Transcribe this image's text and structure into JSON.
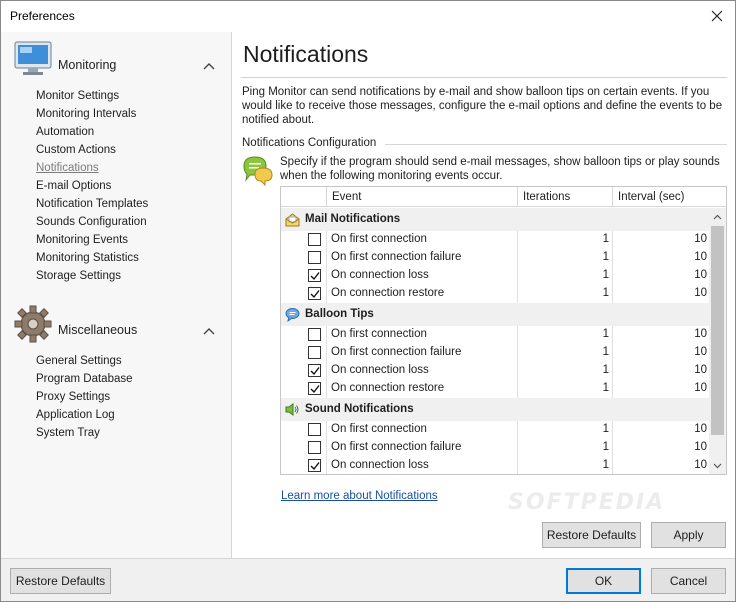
{
  "window": {
    "title": "Preferences"
  },
  "sidebar": {
    "groups": [
      {
        "title": "Monitoring",
        "icon": "monitor-icon",
        "items": [
          "Monitor Settings",
          "Monitoring Intervals",
          "Automation",
          "Custom Actions",
          "Notifications",
          "E-mail Options",
          "Notification Templates",
          "Sounds Configuration",
          "Monitoring Events",
          "Monitoring Statistics",
          "Storage Settings"
        ],
        "active": "Notifications"
      },
      {
        "title": "Miscellaneous",
        "icon": "gear-icon",
        "items": [
          "General Settings",
          "Program Database",
          "Proxy Settings",
          "Application Log",
          "System Tray"
        ]
      }
    ]
  },
  "main": {
    "title": "Notifications",
    "intro": "Ping Monitor can send notifications by e-mail and show balloon tips on certain events. If you would like to receive those messages, configure the e-mail options and define the events to be notified about.",
    "section_label": "Notifications Configuration",
    "description": "Specify if the program should send e-mail messages, show balloon tips or play sounds when the following monitoring events occur.",
    "grid": {
      "columns": [
        "Event",
        "Iterations",
        "Interval (sec)"
      ],
      "sections": [
        {
          "title": "Mail Notifications",
          "icon": "mail-icon",
          "rows": [
            {
              "checked": false,
              "event": "On first connection",
              "iterations": "1",
              "interval": "10"
            },
            {
              "checked": false,
              "event": "On first connection failure",
              "iterations": "1",
              "interval": "10"
            },
            {
              "checked": true,
              "event": "On connection loss",
              "iterations": "1",
              "interval": "10"
            },
            {
              "checked": true,
              "event": "On connection restore",
              "iterations": "1",
              "interval": "10"
            }
          ]
        },
        {
          "title": "Balloon Tips",
          "icon": "balloon-icon",
          "rows": [
            {
              "checked": false,
              "event": "On first connection",
              "iterations": "1",
              "interval": "10"
            },
            {
              "checked": false,
              "event": "On first connection failure",
              "iterations": "1",
              "interval": "10"
            },
            {
              "checked": true,
              "event": "On connection loss",
              "iterations": "1",
              "interval": "10"
            },
            {
              "checked": true,
              "event": "On connection restore",
              "iterations": "1",
              "interval": "10"
            }
          ]
        },
        {
          "title": "Sound Notifications",
          "icon": "speaker-icon",
          "rows": [
            {
              "checked": false,
              "event": "On first connection",
              "iterations": "1",
              "interval": "10"
            },
            {
              "checked": false,
              "event": "On first connection failure",
              "iterations": "1",
              "interval": "10"
            },
            {
              "checked": true,
              "event": "On connection loss",
              "iterations": "1",
              "interval": "10"
            }
          ]
        }
      ]
    },
    "learn_link": "Learn more about Notifications",
    "restore_defaults": "Restore Defaults",
    "apply": "Apply"
  },
  "footer": {
    "restore_defaults": "Restore Defaults",
    "ok": "OK",
    "cancel": "Cancel"
  },
  "watermark": "SOFTPEDIA",
  "colors": {
    "accent": "#0078d7",
    "link": "#1a4f9c",
    "sidebar_bg": "#f7f7f7",
    "section_bg": "#f0f0f0"
  }
}
